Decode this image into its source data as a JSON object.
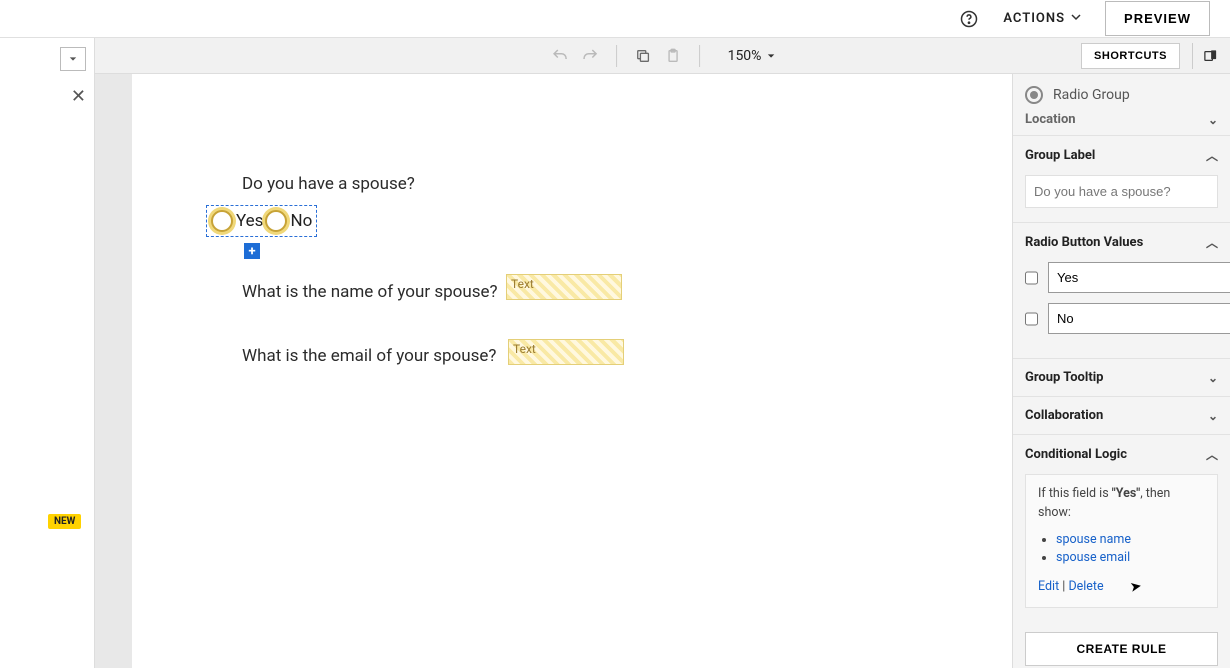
{
  "header": {
    "actions_label": "ACTIONS",
    "preview_label": "PREVIEW"
  },
  "toolbar": {
    "zoom": "150%",
    "shortcuts_label": "SHORTCUTS"
  },
  "left": {
    "new_badge": "NEW"
  },
  "canvas": {
    "question1": "Do you have a spouse?",
    "radio_option_yes": "Yes",
    "radio_option_no": "No",
    "question2": "What is the name of your spouse?",
    "question3": "What is the email of your spouse?",
    "text_placeholder": "Text"
  },
  "right": {
    "component_type": "Radio Group",
    "sections": {
      "location_label": "Location",
      "group_label": {
        "title": "Group Label",
        "value": "Do you have a spouse?"
      },
      "radio_values": {
        "title": "Radio Button Values",
        "items": [
          "Yes",
          "No"
        ]
      },
      "group_tooltip_label": "Group Tooltip",
      "collaboration_label": "Collaboration",
      "conditional_logic": {
        "title": "Conditional Logic",
        "rule_prefix": "If this field is ",
        "rule_value": "\"Yes\"",
        "rule_suffix": ", then show:",
        "targets": [
          "spouse name",
          "spouse email"
        ],
        "edit_label": "Edit",
        "delete_label": "Delete",
        "create_label": "CREATE RULE"
      }
    }
  }
}
